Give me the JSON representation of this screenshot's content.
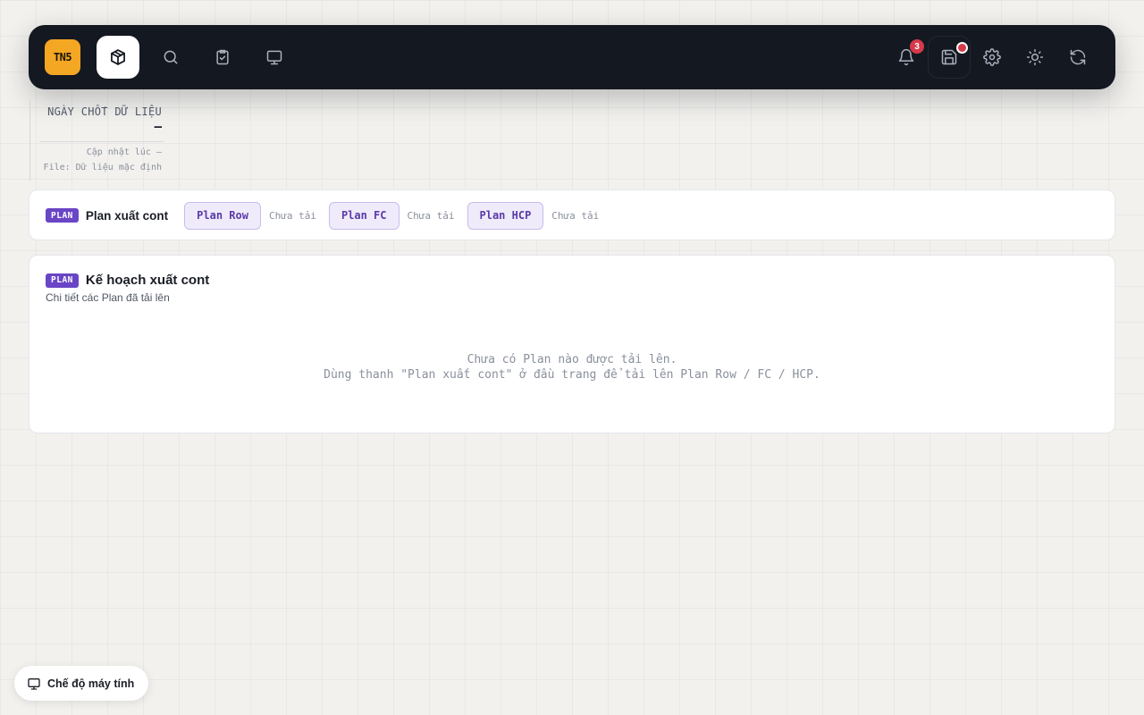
{
  "topbar": {
    "logo_text": "TN5",
    "nav": [
      {
        "icon": "package-icon",
        "active": true
      },
      {
        "icon": "search-icon"
      },
      {
        "icon": "clipboard-check-icon"
      },
      {
        "icon": "monitor-icon"
      }
    ],
    "actions": [
      {
        "icon": "bell-icon",
        "badge": "3"
      },
      {
        "icon": "save-icon",
        "indicator": "unsaved-dot"
      },
      {
        "icon": "gear-icon"
      },
      {
        "icon": "sun-icon"
      },
      {
        "icon": "refresh-icon"
      }
    ],
    "notification_count": "3"
  },
  "data_date": {
    "label": "NGÀY CHỐT DỮ LIỆU",
    "value": "—",
    "updated": "Cập nhật lúc —",
    "file": "File: Dữ liệu mặc định"
  },
  "plan_bar": {
    "tag": "PLAN",
    "title": "Plan xuất cont",
    "items": [
      {
        "label": "Plan Row",
        "status": "Chưa tải"
      },
      {
        "label": "Plan FC",
        "status": "Chưa tải"
      },
      {
        "label": "Plan HCP",
        "status": "Chưa tải"
      }
    ]
  },
  "plan_detail": {
    "tag": "PLAN",
    "title": "Kế hoạch xuất cont",
    "subtitle": "Chi tiết các Plan đã tải lên",
    "empty_line1": "Chưa có Plan nào được tải lên.",
    "empty_line2": "Dùng thanh \"Plan xuất cont\" ở đầu trang để tải lên Plan Row / FC / HCP."
  },
  "mode_button": {
    "icon": "monitor-icon",
    "label": "Chế độ máy tính"
  },
  "colors": {
    "topbar_bg": "#141821",
    "logo_bg": "#f4a723",
    "accent_purple": "#6a45c6",
    "badge_red": "#d63a4a"
  }
}
